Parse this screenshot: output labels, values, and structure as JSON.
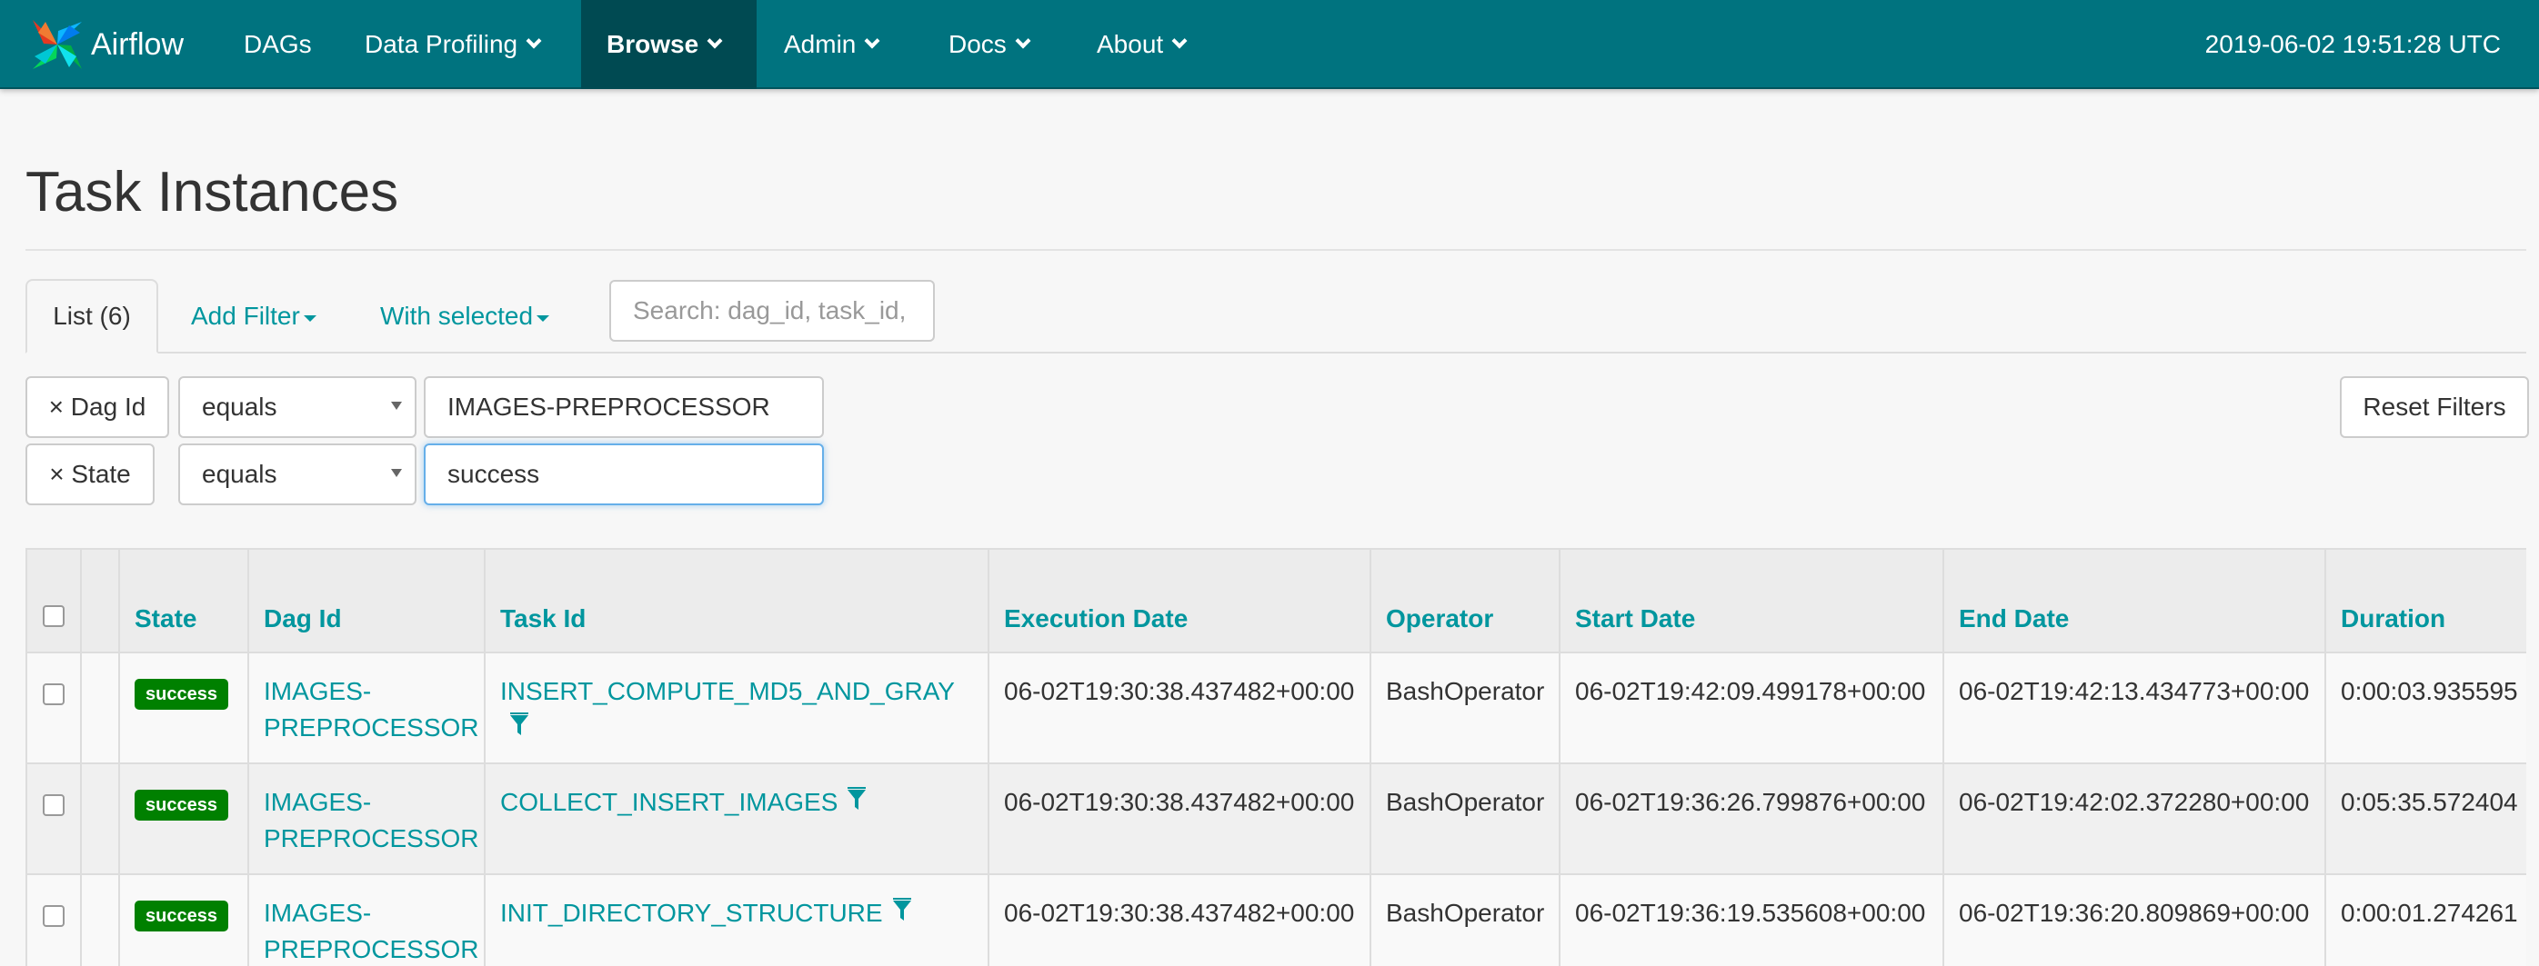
{
  "navbar": {
    "brand": "Airflow",
    "items": [
      {
        "label": "DAGs",
        "dropdown": false
      },
      {
        "label": "Data Profiling",
        "dropdown": true
      },
      {
        "label": "Browse",
        "dropdown": true,
        "active": true
      },
      {
        "label": "Admin",
        "dropdown": true
      },
      {
        "label": "Docs",
        "dropdown": true
      },
      {
        "label": "About",
        "dropdown": true
      }
    ],
    "time": "2019-06-02 19:51:28 UTC",
    "color": "#00737f"
  },
  "page": {
    "title": "Task Instances"
  },
  "tabs": {
    "list": "List (6)",
    "add_filter": "Add Filter",
    "with_selected": "With selected"
  },
  "search": {
    "placeholder": "Search: dag_id, task_id,"
  },
  "filters": [
    {
      "remove_label": "× Dag Id",
      "operator": "equals",
      "value": "IMAGES-PREPROCESSOR"
    },
    {
      "remove_label": "× State",
      "operator": "equals",
      "value": "success"
    }
  ],
  "reset_filters": "Reset Filters",
  "table": {
    "columns": [
      "State",
      "Dag Id",
      "Task Id",
      "Execution Date",
      "Operator",
      "Start Date",
      "End Date",
      "Duration"
    ],
    "rows": [
      {
        "state": "success",
        "dag_id_line1": "IMAGES-",
        "dag_id_line2": "PREPROCESSOR",
        "task_id": "INSERT_COMPUTE_MD5_AND_GRAY",
        "execution_date": "06-02T19:30:38.437482+00:00",
        "operator": "BashOperator",
        "start_date": "06-02T19:42:09.499178+00:00",
        "end_date": "06-02T19:42:13.434773+00:00",
        "duration": "0:00:03.935595"
      },
      {
        "state": "success",
        "dag_id_line1": "IMAGES-",
        "dag_id_line2": "PREPROCESSOR",
        "task_id": "COLLECT_INSERT_IMAGES",
        "execution_date": "06-02T19:30:38.437482+00:00",
        "operator": "BashOperator",
        "start_date": "06-02T19:36:26.799876+00:00",
        "end_date": "06-02T19:42:02.372280+00:00",
        "duration": "0:05:35.572404"
      },
      {
        "state": "success",
        "dag_id_line1": "IMAGES-",
        "dag_id_line2": "PREPROCESSOR",
        "task_id": "INIT_DIRECTORY_STRUCTURE",
        "execution_date": "06-02T19:30:38.437482+00:00",
        "operator": "BashOperator",
        "start_date": "06-02T19:36:19.535608+00:00",
        "end_date": "06-02T19:36:20.809869+00:00",
        "duration": "0:00:01.274261"
      }
    ]
  },
  "colors": {
    "link": "#00969e",
    "success": "#008000"
  },
  "icons": [
    "airflow-logo-icon",
    "chevron-down-icon",
    "caret-down-icon",
    "filter-icon"
  ]
}
